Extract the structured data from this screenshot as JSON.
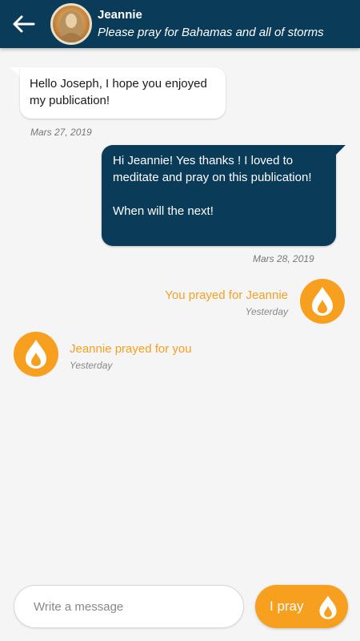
{
  "header": {
    "contact_name": "Jeannie",
    "contact_status": "Please pray for Bahamas and all of storms",
    "back_icon": "arrow-left-icon",
    "avatar": "avatar"
  },
  "messages": [
    {
      "direction": "incoming",
      "text": "Hello Joseph, I hope you enjoyed my publication!",
      "date": "Mars 27, 2019"
    },
    {
      "direction": "outgoing",
      "text": "Hi Jeannie! Yes thanks ! I loved to meditate and pray on this publication!\n\nWhen will the next!",
      "date": "Mars 28, 2019"
    }
  ],
  "prayers": [
    {
      "text": "You prayed for Jeannie",
      "time": "Yesterday",
      "side": "right"
    },
    {
      "text": "Jeannie prayed for you",
      "time": "Yesterday",
      "side": "left"
    }
  ],
  "composer": {
    "placeholder": "Write a message",
    "pray_button_label": "I pray"
  },
  "colors": {
    "primary": "#0a3b59",
    "accent": "#f7a01f",
    "background": "#f5f5f5"
  }
}
